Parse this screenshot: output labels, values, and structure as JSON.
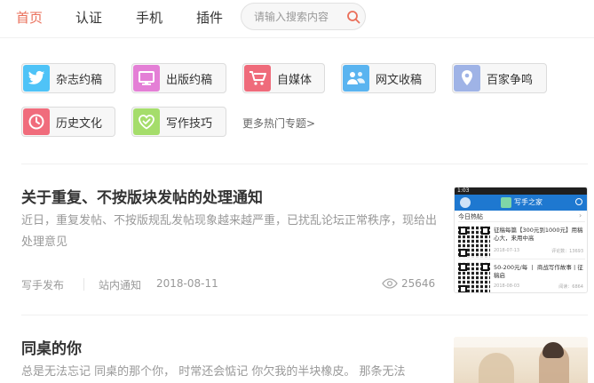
{
  "nav": {
    "items": [
      {
        "label": "首页",
        "active": true
      },
      {
        "label": "认证",
        "active": false
      },
      {
        "label": "手机",
        "active": false
      },
      {
        "label": "插件",
        "active": false
      }
    ],
    "search_placeholder": "请输入搜索内容",
    "search_icon": "search-icon",
    "accent_color": "#ea6f5a"
  },
  "topics": {
    "items": [
      {
        "label": "杂志约稿",
        "icon": "twitter-bird-icon",
        "color": "#4fc3f7"
      },
      {
        "label": "出版约稿",
        "icon": "monitor-icon",
        "color": "#e47fd6"
      },
      {
        "label": "自媒体",
        "icon": "cart-icon",
        "color": "#ef6b7b"
      },
      {
        "label": "网文收稿",
        "icon": "people-icon",
        "color": "#5ab4f0"
      },
      {
        "label": "百家争鸣",
        "icon": "location-pin-icon",
        "color": "#9fb3e6"
      },
      {
        "label": "历史文化",
        "icon": "clock-icon",
        "color": "#f06c7c"
      },
      {
        "label": "写作技巧",
        "icon": "check-heart-icon",
        "color": "#a5dd6b"
      }
    ],
    "more_label": "更多热门专题>"
  },
  "articles": [
    {
      "title": "关于重复、不按版块发帖的处理通知",
      "abstract": "近日，重复发帖、不按版规乱发帖现象越来越严重，已扰乱论坛正常秩序，现给出处理意见",
      "author": "写手发布",
      "category": "站内通知",
      "date": "2018-08-11",
      "views": "25646",
      "thumb": {
        "status_time": "1:03",
        "app_title": "写手之家",
        "section_title": "今日热帖",
        "section_arrow": "›",
        "items": [
          {
            "text": "征稿每篇【300元到1000元】用稿心大，来用中高",
            "date": "2018-07-13",
            "count": "评论数：13693"
          },
          {
            "text": "50-200元/每 丨 商战写作故事丨征稿启",
            "date": "2018-08-03",
            "count": "阅读：6864"
          }
        ]
      }
    },
    {
      "title": "同桌的你",
      "abstract": "总是无法忘记 同桌的那个你， 时常还会惦记 你欠我的半块橡皮。 那条无法"
    }
  ]
}
